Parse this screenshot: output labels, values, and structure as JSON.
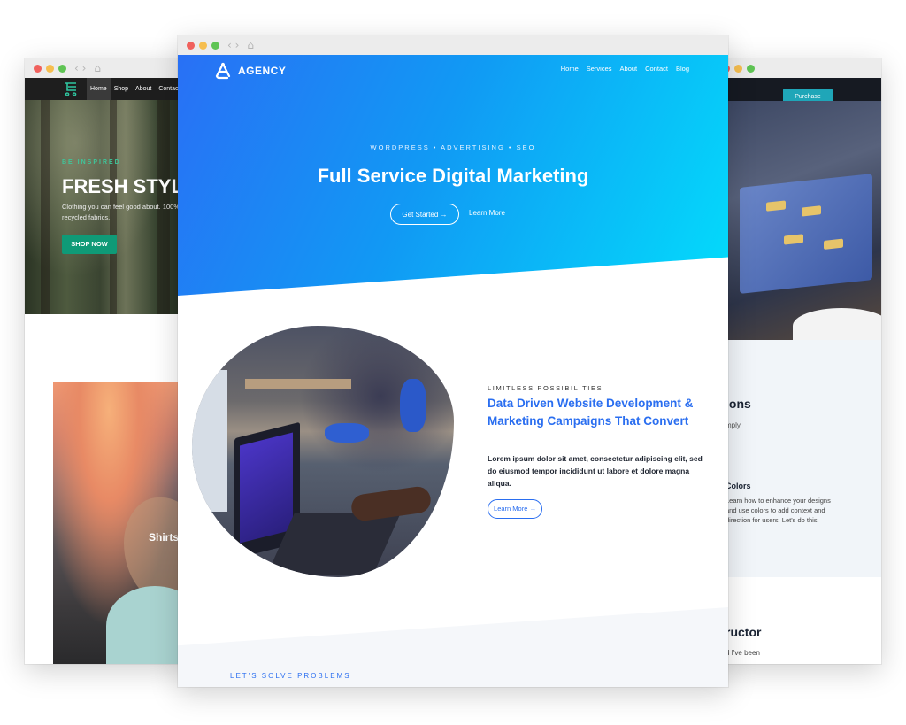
{
  "left_site": {
    "nav": [
      "Home",
      "Shop",
      "About",
      "Contact"
    ],
    "kicker": "BE INSPIRED",
    "title": "FRESH STYLE",
    "description": "Clothing you can feel good about. 100% recycled fabrics.",
    "cta": "SHOP NOW",
    "photo_label": "Shirts"
  },
  "right_site": {
    "button": "Purchase",
    "heading1": "ions",
    "text1": "mply",
    "heading2": "Colors",
    "text2": "Learn how to enhance your designs and use colors to add context and direction for users. Let's do this.",
    "heading3": "ructor",
    "text3": "d I've been"
  },
  "center_site": {
    "brand": "AGENCY",
    "nav": [
      "Home",
      "Services",
      "About",
      "Contact",
      "Blog"
    ],
    "tagline": "WORDPRESS • ADVERTISING • SEO",
    "headline": "Full Service Digital Marketing",
    "primary_cta": "Get Started →",
    "secondary_cta": "Learn More",
    "section_kicker": "LIMITLESS POSSIBILITIES",
    "section_title": "Data Driven Website Development & Marketing Campaigns That Convert",
    "section_body": "Lorem ipsum dolor sit amet, consectetur adipiscing elit, sed do eiusmod tempor incididunt ut labore et dolore magna aliqua.",
    "section_cta": "Learn More →",
    "next_kicker": "LET'S SOLVE PROBLEMS"
  },
  "colors": {
    "hero_gradient_start": "#2970f5",
    "hero_gradient_end": "#03dcfb",
    "accent_blue": "#2a6ef0",
    "left_accent": "#0f9a77",
    "right_accent": "#1fa6b8"
  }
}
